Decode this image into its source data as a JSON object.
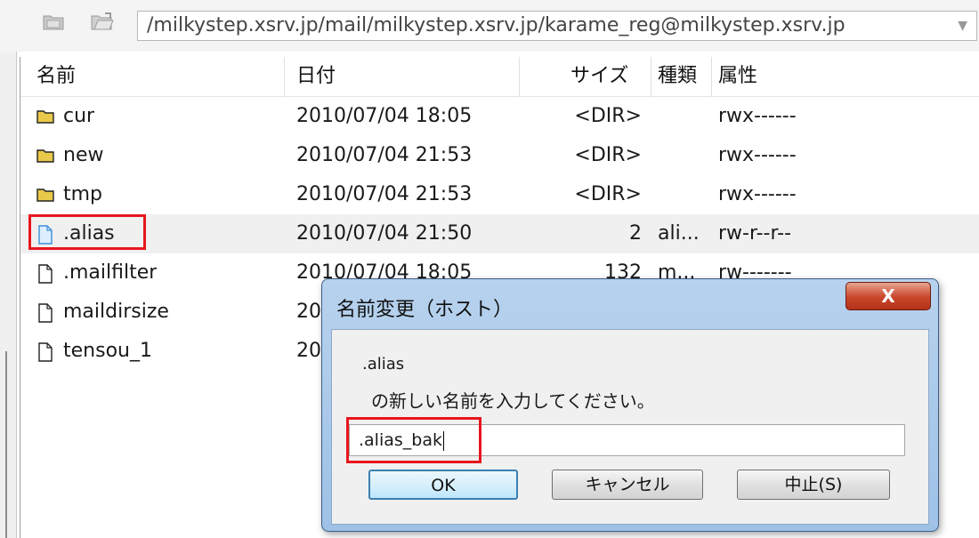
{
  "toolbar": {
    "path": "/milkystep.xsrv.jp/mail/milkystep.xsrv.jp/karame_reg@milkystep.xsrv.jp",
    "up_icon": "folder-up-icon",
    "open_icon": "folder-open-icon"
  },
  "columns": {
    "name": "名前",
    "date": "日付",
    "size": "サイズ",
    "type": "種類",
    "attr": "属性"
  },
  "files": [
    {
      "name": "cur",
      "date": "2010/07/04 18:05",
      "size": "<DIR>",
      "type": "",
      "attr": "rwx------",
      "icon": "folder-icon"
    },
    {
      "name": "new",
      "date": "2010/07/04 21:53",
      "size": "<DIR>",
      "type": "",
      "attr": "rwx------",
      "icon": "folder-icon"
    },
    {
      "name": "tmp",
      "date": "2010/07/04 21:53",
      "size": "<DIR>",
      "type": "",
      "attr": "rwx------",
      "icon": "folder-icon"
    },
    {
      "name": ".alias",
      "date": "2010/07/04 21:50",
      "size": "2",
      "type": "ali...",
      "attr": "rw-r--r--",
      "icon": "file-icon",
      "selected": true
    },
    {
      "name": ".mailfilter",
      "date": "2010/07/04 18:05",
      "size": "132",
      "type": "m...",
      "attr": "rw-------",
      "icon": "file-icon"
    },
    {
      "name": "maildirsize",
      "date": "20",
      "size": "",
      "type": "",
      "attr": "",
      "icon": "file-icon"
    },
    {
      "name": "tensou_1",
      "date": "20",
      "size": "",
      "type": "",
      "attr": "",
      "icon": "file-icon"
    }
  ],
  "dialog": {
    "title": "名前変更（ホスト）",
    "close_label": "X",
    "filename": ".alias",
    "prompt": "の新しい名前を入力してください。",
    "input_value": ".alias_bak",
    "ok_label": "OK",
    "cancel_label": "キャンセル",
    "abort_label": "中止(S)"
  },
  "colors": {
    "highlight": "#e8151d",
    "selected_row": "#f0f0f0",
    "folder": "#e9c94a"
  }
}
